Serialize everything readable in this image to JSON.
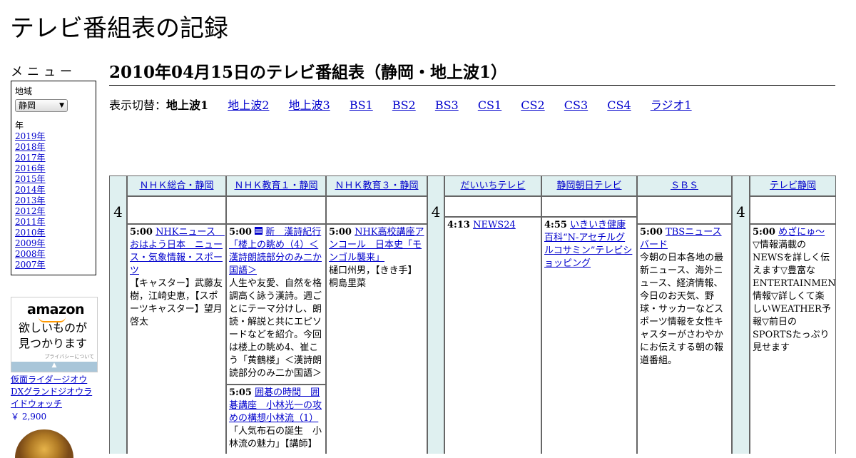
{
  "site_title": "テレビ番組表の記録",
  "menu": {
    "label": "メニュー",
    "region_label": "地域",
    "region_value": "静岡",
    "year_label": "年",
    "years": [
      "2019年",
      "2018年",
      "2017年",
      "2016年",
      "2015年",
      "2014年",
      "2013年",
      "2012年",
      "2011年",
      "2010年",
      "2009年",
      "2008年",
      "2007年"
    ]
  },
  "ad": {
    "logo": "amazon",
    "text": "欲しいものが見つかります",
    "privacy": "プライバシーについて",
    "product_name": "仮面ライダージオウ DXグランドジオウライドウォッチ",
    "product_price": "￥ 2,900"
  },
  "heading": "2010年04月15日のテレビ番組表（静岡・地上波1）",
  "switch": {
    "label": "表示切替：",
    "current": "地上波1",
    "links": [
      "地上波2",
      "地上波3",
      "BS1",
      "BS2",
      "BS3",
      "CS1",
      "CS2",
      "CS3",
      "CS4",
      "ラジオ1"
    ]
  },
  "hour": "4",
  "channels": [
    "ＮＨＫ総合・静岡",
    "ＮＨＫ教育１・静岡",
    "ＮＨＫ教育３・静岡",
    "だいいちテレビ",
    "静岡朝日テレビ",
    "ＳＢＳ",
    "テレビ静岡"
  ],
  "programs": {
    "nhk_g": {
      "time": "5:00",
      "title": "NHKニュース　おはよう日本　ニュース・気象情報・スポーツ",
      "desc": "【キャスター】武藤友樹，江崎史恵，【スポーツキャスター】望月啓太"
    },
    "nhk_e1a": {
      "time": "5:00",
      "title": "新　漢詩紀行「楼上の眺め（4）＜漢詩朗読部分のみ二か国語＞",
      "desc": "人生や友愛、自然を格調高く詠う漢詩。週ごとにテーマ分けし、朗読・解説と共にエピソードなどを紹介。今回は楼上の眺め4、崔こう「黄鶴楼」＜漢詩朗読部分のみ二か国語＞"
    },
    "nhk_e1b": {
      "time": "5:05",
      "title": "囲碁の時間　囲碁講座　小林光一の攻めの構想小林流（1）",
      "desc": "「人気布石の誕生　小林流の魅力」【講師】"
    },
    "nhk_e3": {
      "time": "5:00",
      "title": "NHK高校講座アンコール　日本史「モンゴル襲来」",
      "desc": "樋口州男，【きき手】桐島里菜"
    },
    "daiichi": {
      "time": "4:13",
      "title": "NEWS24",
      "desc": ""
    },
    "asahi": {
      "time": "4:55",
      "title": "いきいき健康百科“N-アセチルグルコサミン”テレビショッピング",
      "desc": ""
    },
    "sbs": {
      "time": "5:00",
      "title": "TBSニュースバード",
      "desc": "今朝の日本各地の最新ニュース、海外ニュース、経済情報、今日のお天気、野球・サッカーなどスポーツ情報を女性キャスターがさわやかにお伝えする朝の報道番組。"
    },
    "tv_shizuoka": {
      "time": "5:00",
      "title": "めざにゅ～",
      "desc": "▽情報満載のNEWSを詳しく伝えます▽豊富なENTERTAINMENT情報▽詳しくて楽しいWEATHER予報▽前日のSPORTSたっぷり見せます"
    }
  },
  "colors": {
    "header_bg": "#dff0f0",
    "link": "#0000cc",
    "border": "#666666"
  }
}
